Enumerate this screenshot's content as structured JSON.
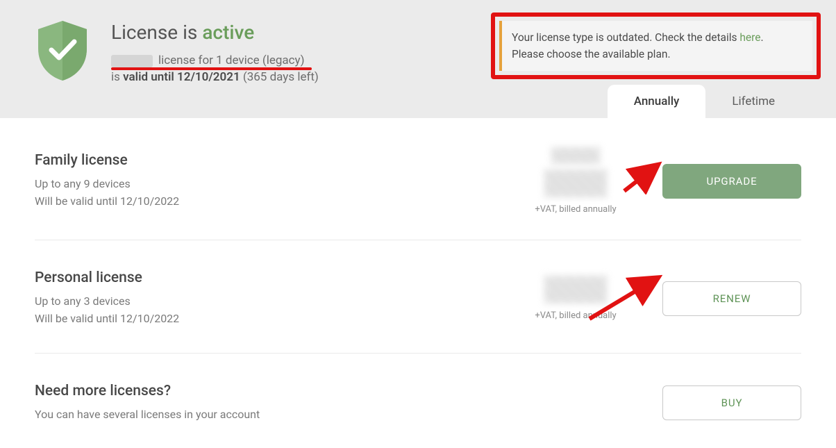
{
  "header": {
    "title_prefix": "License is ",
    "title_status": "active",
    "line1_rest": "license for 1 device (legacy)",
    "line2_prefix": "is ",
    "line2_bold": "valid until 12/10/2021",
    "line2_suffix": " (365 days left)"
  },
  "notice": {
    "text1": "Your license type is outdated. Check the details ",
    "link": "here",
    "text2": ".",
    "line2": "Please choose the available plan."
  },
  "tabs": {
    "annually": "Annually",
    "lifetime": "Lifetime",
    "active": "annually"
  },
  "plans": [
    {
      "title": "Family license",
      "sub1": "Up to any 9 devices",
      "sub2": "Will be valid until 12/10/2022",
      "price_note": "+VAT, billed annually",
      "button": "UPGRADE",
      "button_style": "filled"
    },
    {
      "title": "Personal license",
      "sub1": "Up to any 3 devices",
      "sub2": "Will be valid until 12/10/2022",
      "price_note": "+VAT, billed annually",
      "button": "RENEW",
      "button_style": "outline"
    }
  ],
  "more": {
    "title": "Need more licenses?",
    "sub": "You can have several licenses in your account",
    "button": "BUY"
  }
}
